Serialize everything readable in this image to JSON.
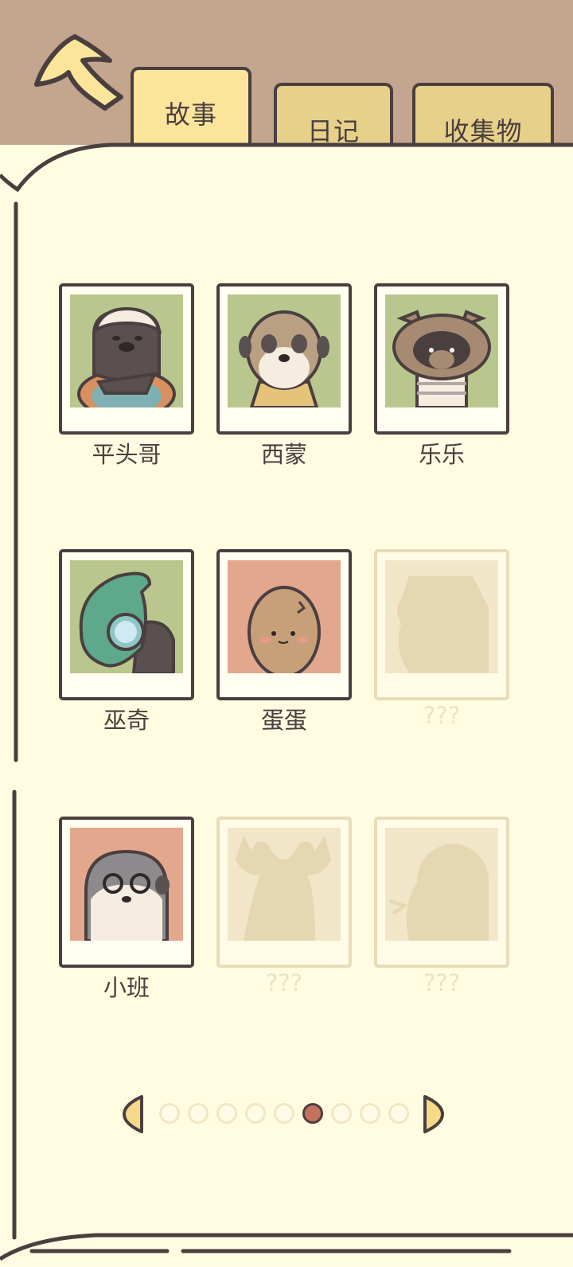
{
  "tabs": [
    {
      "label": "故事",
      "active": true
    },
    {
      "label": "日记",
      "active": false
    },
    {
      "label": "收集物",
      "active": false
    }
  ],
  "characters": [
    {
      "name": "平头哥",
      "locked": false,
      "bg": "#b9c68d",
      "icon": "honey-badger-portrait"
    },
    {
      "name": "西蒙",
      "locked": false,
      "bg": "#b9c68d",
      "icon": "meerkat-portrait"
    },
    {
      "name": "乐乐",
      "locked": false,
      "bg": "#b9c68d",
      "icon": "raccoon-portrait"
    },
    {
      "name": "巫奇",
      "locked": false,
      "bg": "#b9c68d",
      "icon": "chameleon-portrait"
    },
    {
      "name": "蛋蛋",
      "locked": false,
      "bg": "#e3a78e",
      "icon": "potato-egg-portrait"
    },
    {
      "name": "???",
      "locked": true,
      "bg": "#f2e6c9",
      "icon": "locked-silhouette"
    },
    {
      "name": "小班",
      "locked": false,
      "bg": "#e3a78e",
      "icon": "otter-portrait"
    },
    {
      "name": "???",
      "locked": true,
      "bg": "#f2e6c9",
      "icon": "moose-silhouette"
    },
    {
      "name": "???",
      "locked": true,
      "bg": "#f2e6c9",
      "icon": "bird-silhouette"
    }
  ],
  "pager": {
    "total": 9,
    "current": 6
  },
  "colors": {
    "outline": "#4a3f3f",
    "accent": "#fbe59b",
    "page": "#fffce1",
    "frame": "#c4a58d"
  }
}
